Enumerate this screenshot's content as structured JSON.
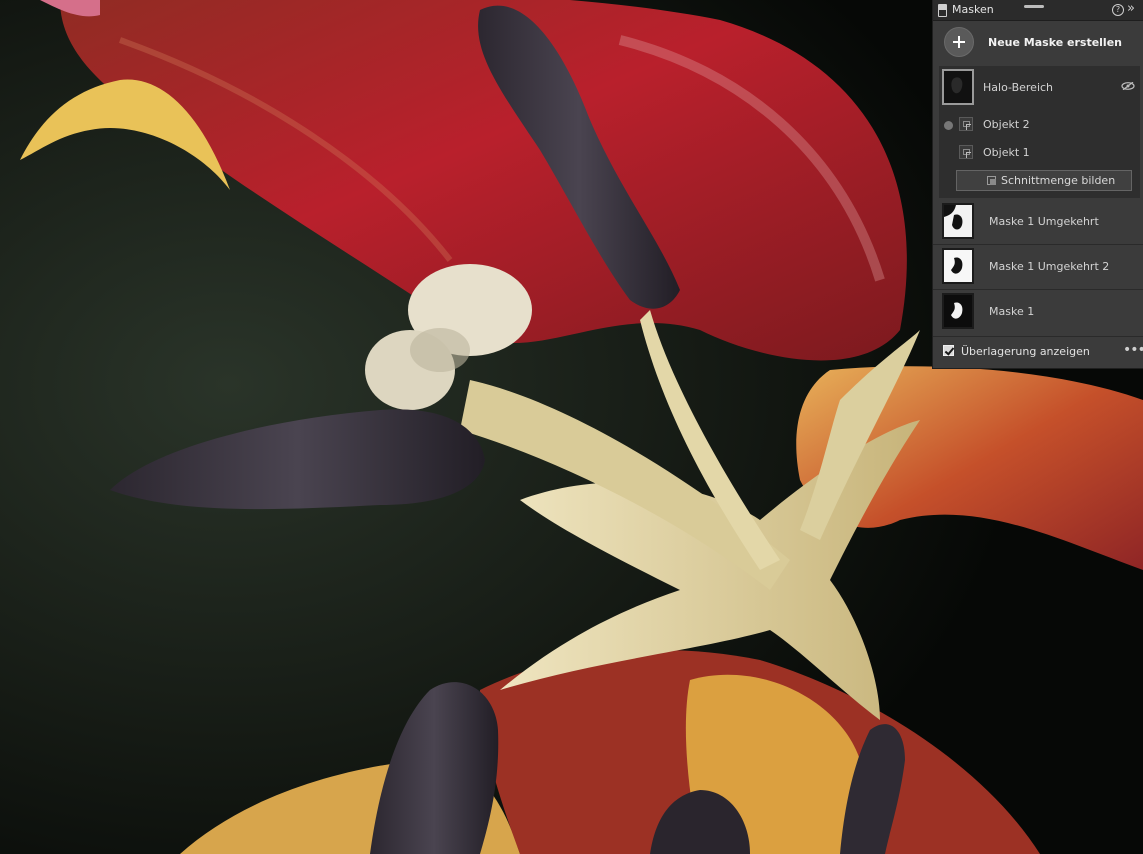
{
  "panel": {
    "title": "Masken",
    "help_glyph": "?",
    "collapse_glyph": "»",
    "new_mask_label": "Neue Maske erstellen",
    "mask_group": {
      "name": "Halo-Bereich",
      "components": [
        {
          "label": "Objekt 2"
        },
        {
          "label": "Objekt 1"
        }
      ],
      "intersect_button_label": "Schnittmenge bilden"
    },
    "masks": [
      {
        "label": "Maske 1 Umgekehrt"
      },
      {
        "label": "Maske 1 Umgekehrt 2"
      },
      {
        "label": "Maske 1"
      }
    ],
    "overlay": {
      "label": "Überlagerung anzeigen",
      "checked": true
    },
    "more_glyph": "•••"
  },
  "colors": {
    "panel_bg": "#3b3b3b",
    "titlebar_bg": "#2b2b2b",
    "group_bg": "#2e2e2e",
    "photo_background": "#0d0f0c",
    "petal_red": "#b3202c",
    "petal_cream": "#e2d4a2",
    "anther_dark": "#2c2730"
  },
  "icons": {
    "panel": "panel-doc-icon",
    "new_mask": "plus-circle-icon",
    "hide": "eye-slash-icon",
    "subject": "select-subject-icon",
    "intersect": "intersect-icon",
    "overlay": "checkbox-icon",
    "more": "more-options-icon"
  }
}
